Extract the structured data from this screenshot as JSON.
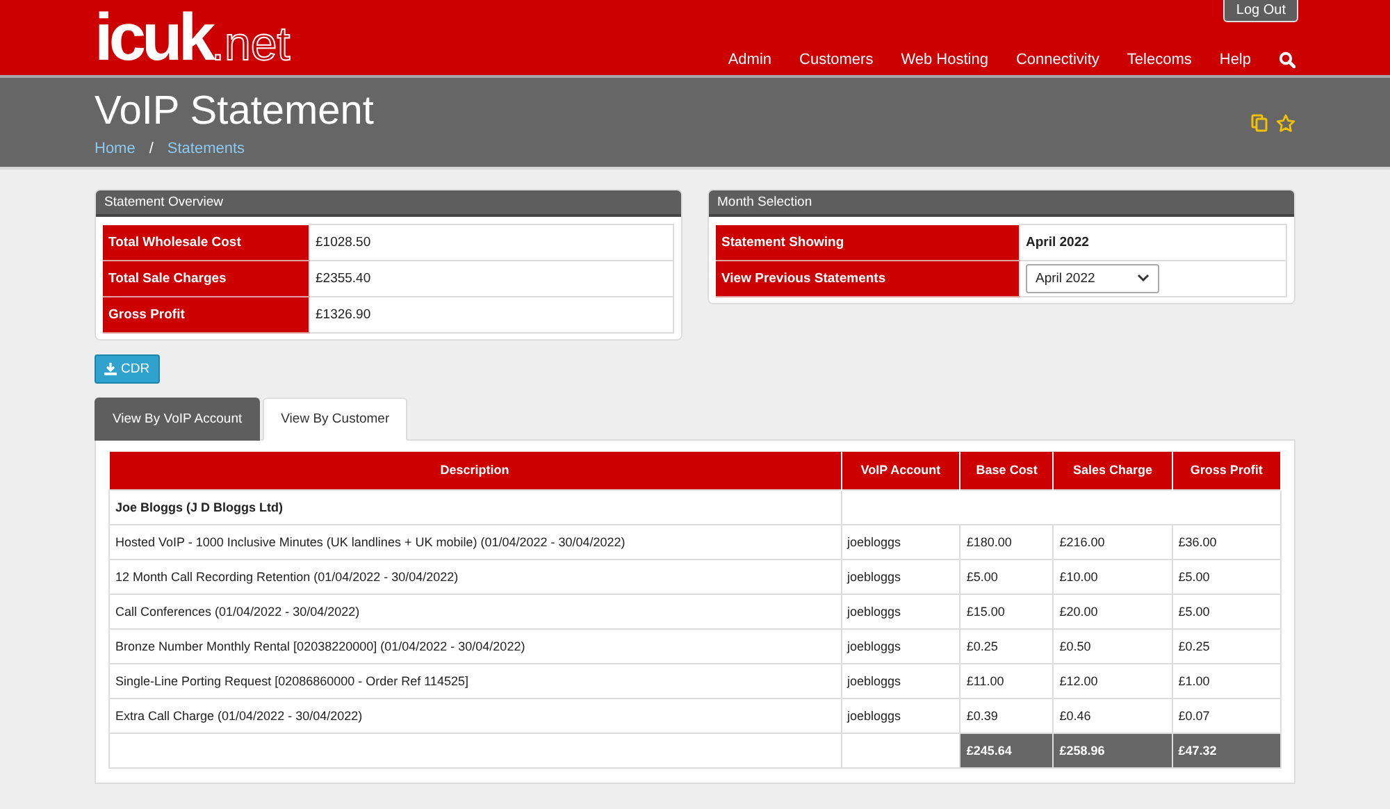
{
  "header": {
    "logo_main": "icuk",
    "logo_suffix": ".net",
    "logout": "Log Out",
    "nav": [
      "Admin",
      "Customers",
      "Web Hosting",
      "Connectivity",
      "Telecoms",
      "Help"
    ]
  },
  "page": {
    "title": "VoIP Statement",
    "breadcrumbs": [
      "Home",
      "Statements"
    ],
    "separator": "/"
  },
  "overview": {
    "title": "Statement Overview",
    "rows": [
      {
        "label": "Total Wholesale Cost",
        "value": "£1028.50"
      },
      {
        "label": "Total Sale Charges",
        "value": "£2355.40"
      },
      {
        "label": "Gross Profit",
        "value": "£1326.90"
      }
    ]
  },
  "month": {
    "title": "Month Selection",
    "rows": [
      {
        "label": "Statement Showing",
        "kind": "text",
        "value": "April 2022"
      },
      {
        "label": "View Previous Statements",
        "kind": "select",
        "value": "April 2022"
      }
    ]
  },
  "cdr_button": "CDR",
  "tabs": [
    {
      "label": "View By VoIP Account",
      "selected": false
    },
    {
      "label": "View By Customer",
      "selected": true
    }
  ],
  "table": {
    "columns": [
      "Description",
      "VoIP Account",
      "Base Cost",
      "Sales Charge",
      "Gross Profit"
    ],
    "group": "Joe Bloggs (J D Bloggs Ltd)",
    "rows": [
      [
        "Hosted VoIP - 1000 Inclusive Minutes (UK landlines + UK mobile) (01/04/2022 - 30/04/2022)",
        "joebloggs",
        "£180.00",
        "£216.00",
        "£36.00"
      ],
      [
        "12 Month Call Recording Retention (01/04/2022 - 30/04/2022)",
        "joebloggs",
        "£5.00",
        "£10.00",
        "£5.00"
      ],
      [
        "Call Conferences (01/04/2022 - 30/04/2022)",
        "joebloggs",
        "£15.00",
        "£20.00",
        "£5.00"
      ],
      [
        "Bronze Number Monthly Rental [02038220000] (01/04/2022 - 30/04/2022)",
        "joebloggs",
        "£0.25",
        "£0.50",
        "£0.25"
      ],
      [
        "Single-Line Porting Request [02086860000 - Order Ref 114525]",
        "joebloggs",
        "£11.00",
        "£12.00",
        "£1.00"
      ],
      [
        "Extra Call Charge (01/04/2022 - 30/04/2022)",
        "joebloggs",
        "£0.39",
        "£0.46",
        "£0.07"
      ]
    ],
    "totals": [
      "£245.64",
      "£258.96",
      "£47.32"
    ]
  }
}
